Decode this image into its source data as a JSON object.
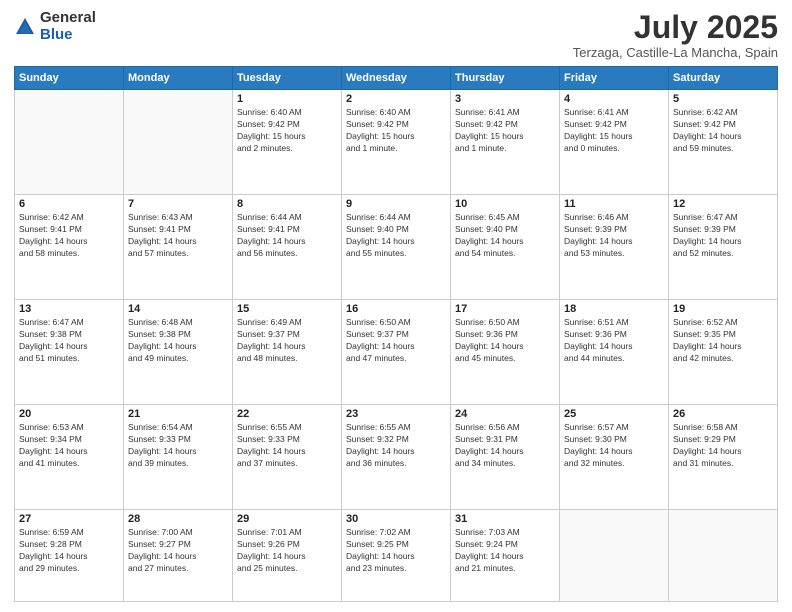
{
  "logo": {
    "general": "General",
    "blue": "Blue"
  },
  "header": {
    "title": "July 2025",
    "subtitle": "Terzaga, Castille-La Mancha, Spain"
  },
  "weekdays": [
    "Sunday",
    "Monday",
    "Tuesday",
    "Wednesday",
    "Thursday",
    "Friday",
    "Saturday"
  ],
  "weeks": [
    [
      {
        "day": "",
        "info": ""
      },
      {
        "day": "",
        "info": ""
      },
      {
        "day": "1",
        "info": "Sunrise: 6:40 AM\nSunset: 9:42 PM\nDaylight: 15 hours\nand 2 minutes."
      },
      {
        "day": "2",
        "info": "Sunrise: 6:40 AM\nSunset: 9:42 PM\nDaylight: 15 hours\nand 1 minute."
      },
      {
        "day": "3",
        "info": "Sunrise: 6:41 AM\nSunset: 9:42 PM\nDaylight: 15 hours\nand 1 minute."
      },
      {
        "day": "4",
        "info": "Sunrise: 6:41 AM\nSunset: 9:42 PM\nDaylight: 15 hours\nand 0 minutes."
      },
      {
        "day": "5",
        "info": "Sunrise: 6:42 AM\nSunset: 9:42 PM\nDaylight: 14 hours\nand 59 minutes."
      }
    ],
    [
      {
        "day": "6",
        "info": "Sunrise: 6:42 AM\nSunset: 9:41 PM\nDaylight: 14 hours\nand 58 minutes."
      },
      {
        "day": "7",
        "info": "Sunrise: 6:43 AM\nSunset: 9:41 PM\nDaylight: 14 hours\nand 57 minutes."
      },
      {
        "day": "8",
        "info": "Sunrise: 6:44 AM\nSunset: 9:41 PM\nDaylight: 14 hours\nand 56 minutes."
      },
      {
        "day": "9",
        "info": "Sunrise: 6:44 AM\nSunset: 9:40 PM\nDaylight: 14 hours\nand 55 minutes."
      },
      {
        "day": "10",
        "info": "Sunrise: 6:45 AM\nSunset: 9:40 PM\nDaylight: 14 hours\nand 54 minutes."
      },
      {
        "day": "11",
        "info": "Sunrise: 6:46 AM\nSunset: 9:39 PM\nDaylight: 14 hours\nand 53 minutes."
      },
      {
        "day": "12",
        "info": "Sunrise: 6:47 AM\nSunset: 9:39 PM\nDaylight: 14 hours\nand 52 minutes."
      }
    ],
    [
      {
        "day": "13",
        "info": "Sunrise: 6:47 AM\nSunset: 9:38 PM\nDaylight: 14 hours\nand 51 minutes."
      },
      {
        "day": "14",
        "info": "Sunrise: 6:48 AM\nSunset: 9:38 PM\nDaylight: 14 hours\nand 49 minutes."
      },
      {
        "day": "15",
        "info": "Sunrise: 6:49 AM\nSunset: 9:37 PM\nDaylight: 14 hours\nand 48 minutes."
      },
      {
        "day": "16",
        "info": "Sunrise: 6:50 AM\nSunset: 9:37 PM\nDaylight: 14 hours\nand 47 minutes."
      },
      {
        "day": "17",
        "info": "Sunrise: 6:50 AM\nSunset: 9:36 PM\nDaylight: 14 hours\nand 45 minutes."
      },
      {
        "day": "18",
        "info": "Sunrise: 6:51 AM\nSunset: 9:36 PM\nDaylight: 14 hours\nand 44 minutes."
      },
      {
        "day": "19",
        "info": "Sunrise: 6:52 AM\nSunset: 9:35 PM\nDaylight: 14 hours\nand 42 minutes."
      }
    ],
    [
      {
        "day": "20",
        "info": "Sunrise: 6:53 AM\nSunset: 9:34 PM\nDaylight: 14 hours\nand 41 minutes."
      },
      {
        "day": "21",
        "info": "Sunrise: 6:54 AM\nSunset: 9:33 PM\nDaylight: 14 hours\nand 39 minutes."
      },
      {
        "day": "22",
        "info": "Sunrise: 6:55 AM\nSunset: 9:33 PM\nDaylight: 14 hours\nand 37 minutes."
      },
      {
        "day": "23",
        "info": "Sunrise: 6:55 AM\nSunset: 9:32 PM\nDaylight: 14 hours\nand 36 minutes."
      },
      {
        "day": "24",
        "info": "Sunrise: 6:56 AM\nSunset: 9:31 PM\nDaylight: 14 hours\nand 34 minutes."
      },
      {
        "day": "25",
        "info": "Sunrise: 6:57 AM\nSunset: 9:30 PM\nDaylight: 14 hours\nand 32 minutes."
      },
      {
        "day": "26",
        "info": "Sunrise: 6:58 AM\nSunset: 9:29 PM\nDaylight: 14 hours\nand 31 minutes."
      }
    ],
    [
      {
        "day": "27",
        "info": "Sunrise: 6:59 AM\nSunset: 9:28 PM\nDaylight: 14 hours\nand 29 minutes."
      },
      {
        "day": "28",
        "info": "Sunrise: 7:00 AM\nSunset: 9:27 PM\nDaylight: 14 hours\nand 27 minutes."
      },
      {
        "day": "29",
        "info": "Sunrise: 7:01 AM\nSunset: 9:26 PM\nDaylight: 14 hours\nand 25 minutes."
      },
      {
        "day": "30",
        "info": "Sunrise: 7:02 AM\nSunset: 9:25 PM\nDaylight: 14 hours\nand 23 minutes."
      },
      {
        "day": "31",
        "info": "Sunrise: 7:03 AM\nSunset: 9:24 PM\nDaylight: 14 hours\nand 21 minutes."
      },
      {
        "day": "",
        "info": ""
      },
      {
        "day": "",
        "info": ""
      }
    ]
  ]
}
